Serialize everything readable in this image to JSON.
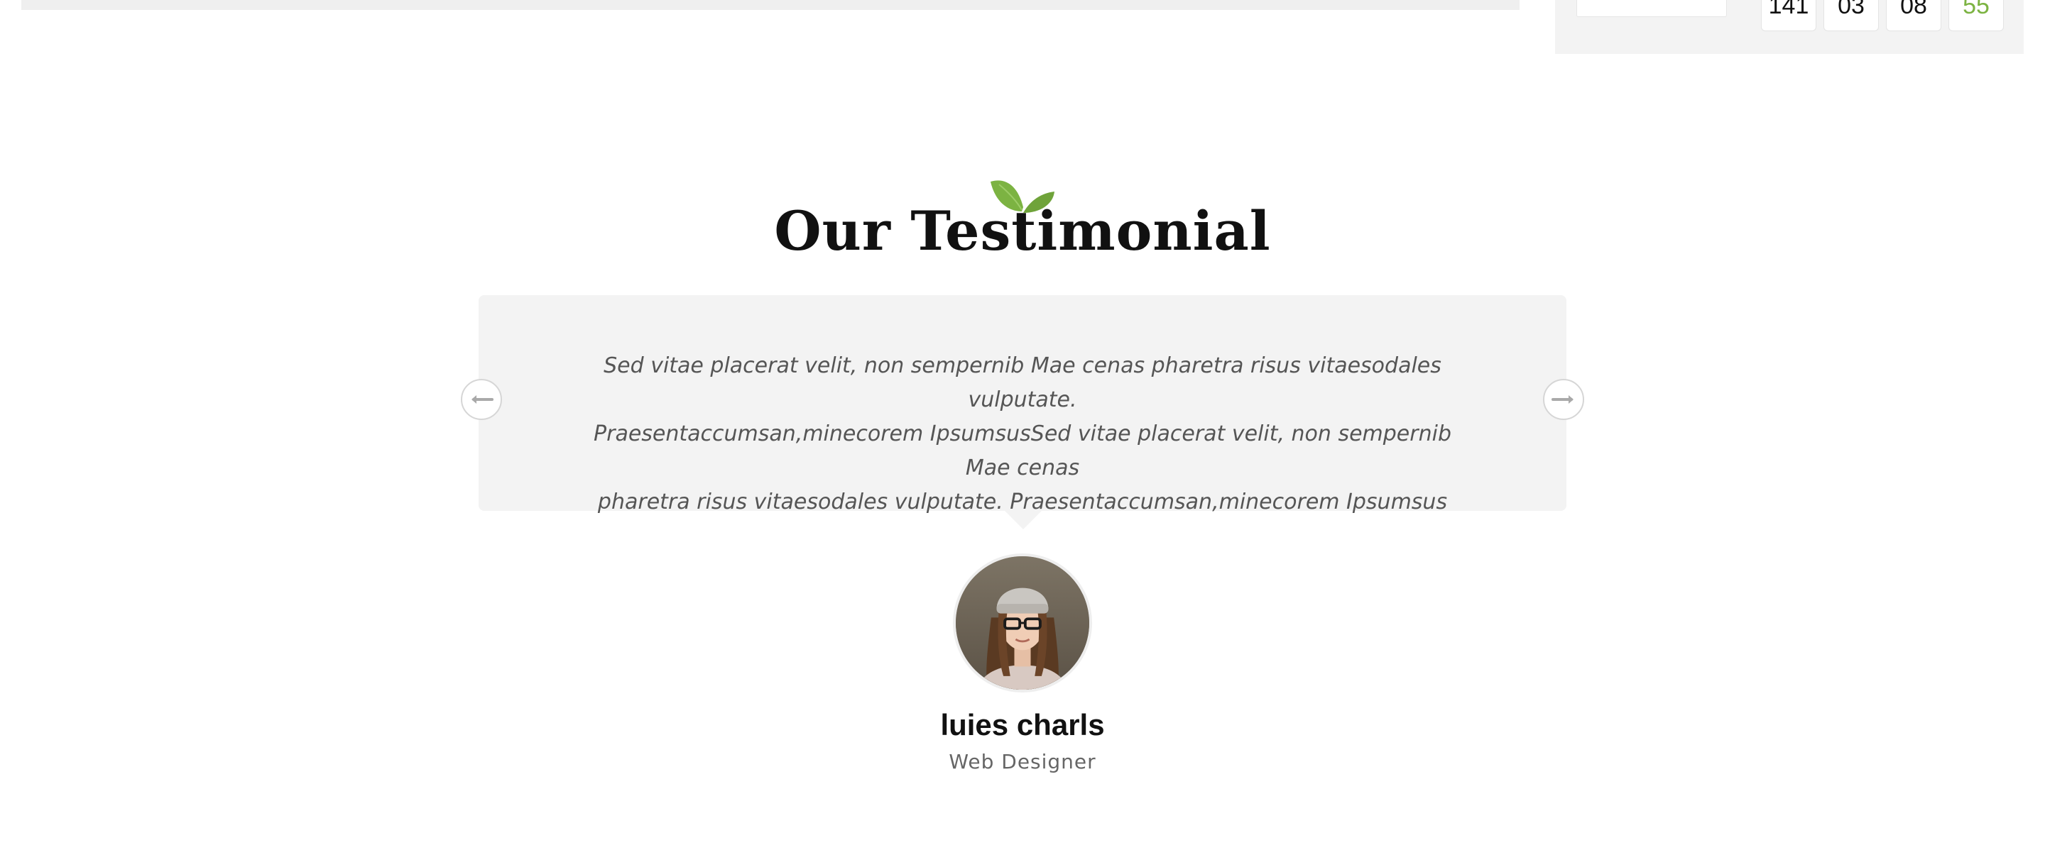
{
  "countdown": {
    "values": [
      "141",
      "03",
      "08",
      "55"
    ]
  },
  "testimonial": {
    "section_title": "Our Testimonial",
    "quote_lines": [
      "Sed vitae placerat velit, non sempernib Mae cenas pharetra risus vitaesodales vulputate.",
      "Praesentaccumsan,minecorem IpsumsusSed vitae placerat velit, non sempernib Mae cenas",
      "pharetra risus vitaesodales vulputate. Praesentaccumsan,minecorem Ipsumsus"
    ],
    "author_name": "luies charls",
    "author_role": "Web Designer",
    "prev_icon": "arrow-left-icon",
    "next_icon": "arrow-right-icon",
    "logo_icon": "leaf-icon"
  },
  "colors": {
    "accent_green": "#7cb342",
    "card_background": "#f3f3f3",
    "heading": "#111111",
    "quote_text": "#555555"
  }
}
